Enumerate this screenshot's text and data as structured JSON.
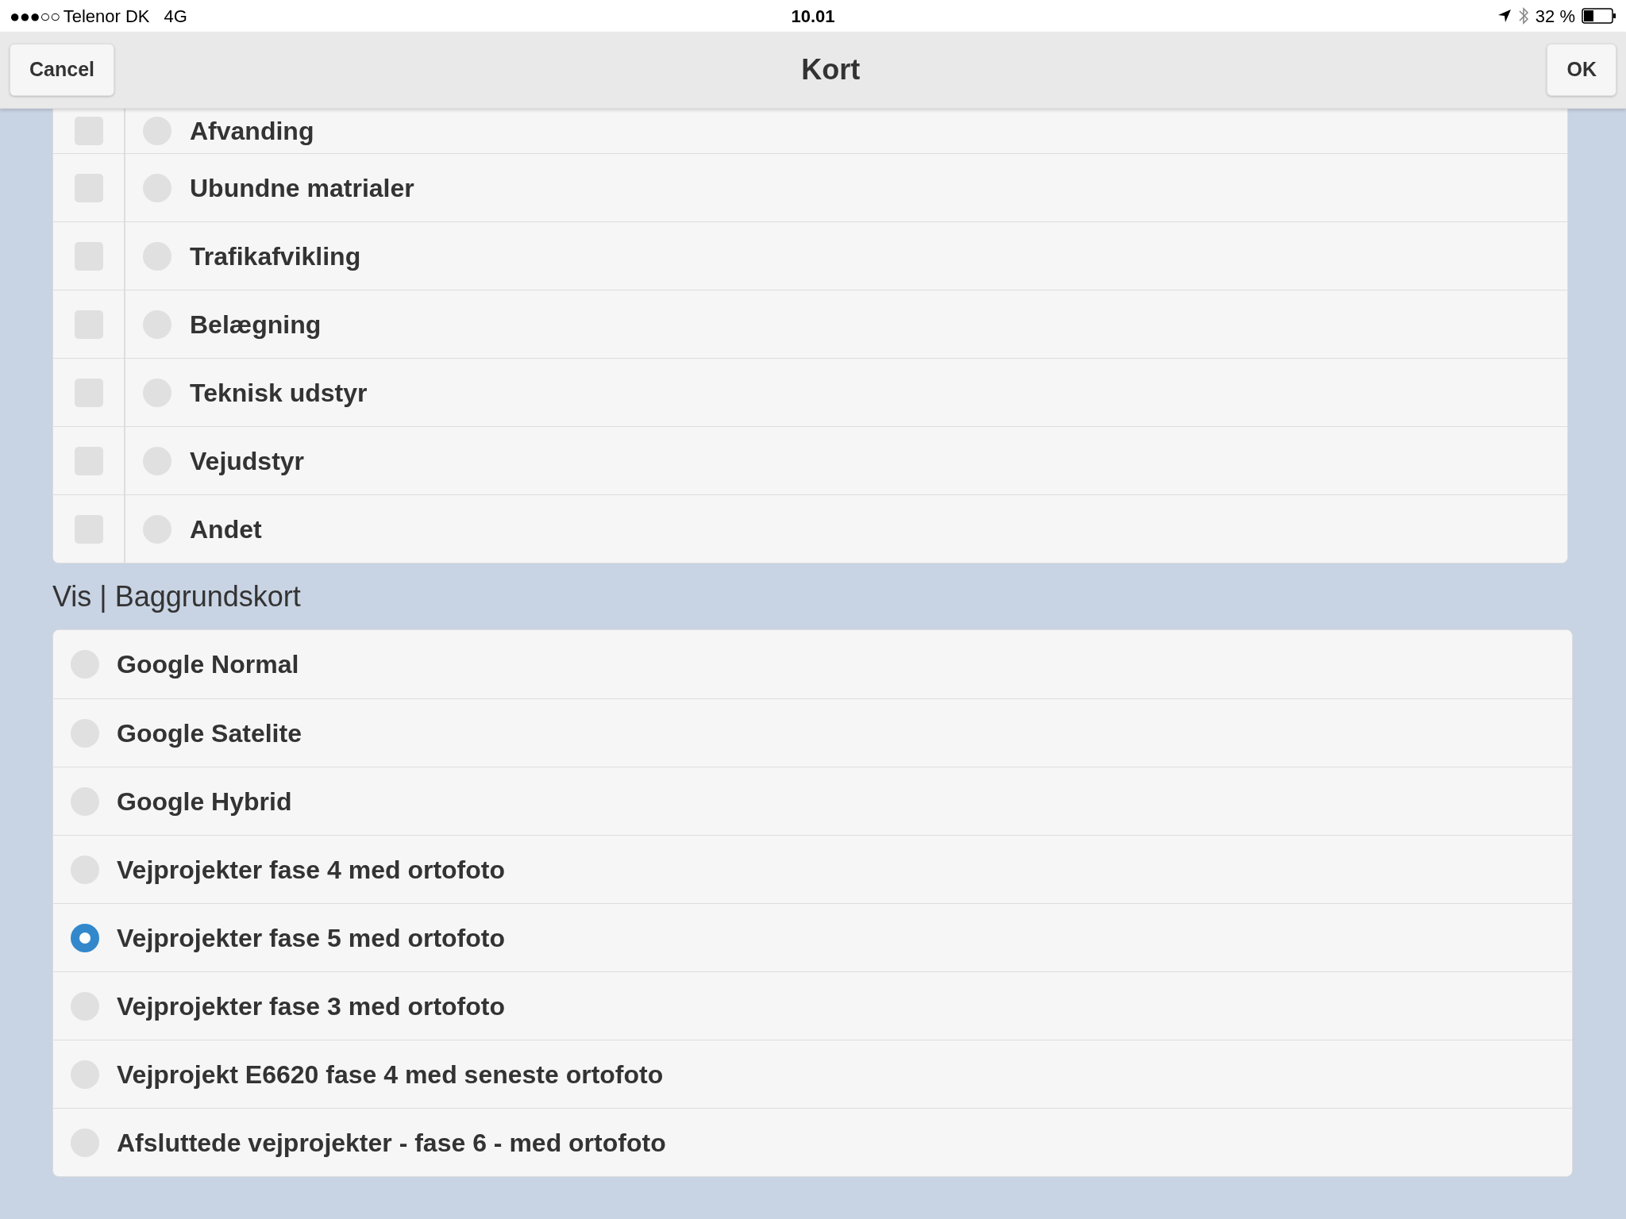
{
  "status_bar": {
    "signal": "●●●○○",
    "carrier": "Telenor DK",
    "network": "4G",
    "time": "10.01",
    "battery": "32 %"
  },
  "header": {
    "title": "Kort",
    "cancel": "Cancel",
    "ok": "OK"
  },
  "layers": [
    {
      "label": "Afvanding",
      "checked": false,
      "selected": false
    },
    {
      "label": "Ubundne matrialer",
      "checked": false,
      "selected": false
    },
    {
      "label": "Trafikafvikling",
      "checked": false,
      "selected": false
    },
    {
      "label": "Belægning",
      "checked": false,
      "selected": false
    },
    {
      "label": "Teknisk udstyr",
      "checked": false,
      "selected": false
    },
    {
      "label": "Vejudstyr",
      "checked": false,
      "selected": false
    },
    {
      "label": "Andet",
      "checked": false,
      "selected": false
    }
  ],
  "background_section": {
    "title": "Vis | Baggrundskort"
  },
  "background_maps": [
    {
      "label": "Google Normal",
      "selected": false
    },
    {
      "label": "Google Satelite",
      "selected": false
    },
    {
      "label": "Google Hybrid",
      "selected": false
    },
    {
      "label": "Vejprojekter fase 4 med ortofoto",
      "selected": false
    },
    {
      "label": "Vejprojekter fase 5 med ortofoto",
      "selected": true
    },
    {
      "label": "Vejprojekter fase 3 med ortofoto",
      "selected": false
    },
    {
      "label": "Vejprojekt E6620 fase 4 med seneste ortofoto",
      "selected": false
    },
    {
      "label": "Afsluttede vejprojekter - fase 6 - med ortofoto",
      "selected": false
    }
  ]
}
